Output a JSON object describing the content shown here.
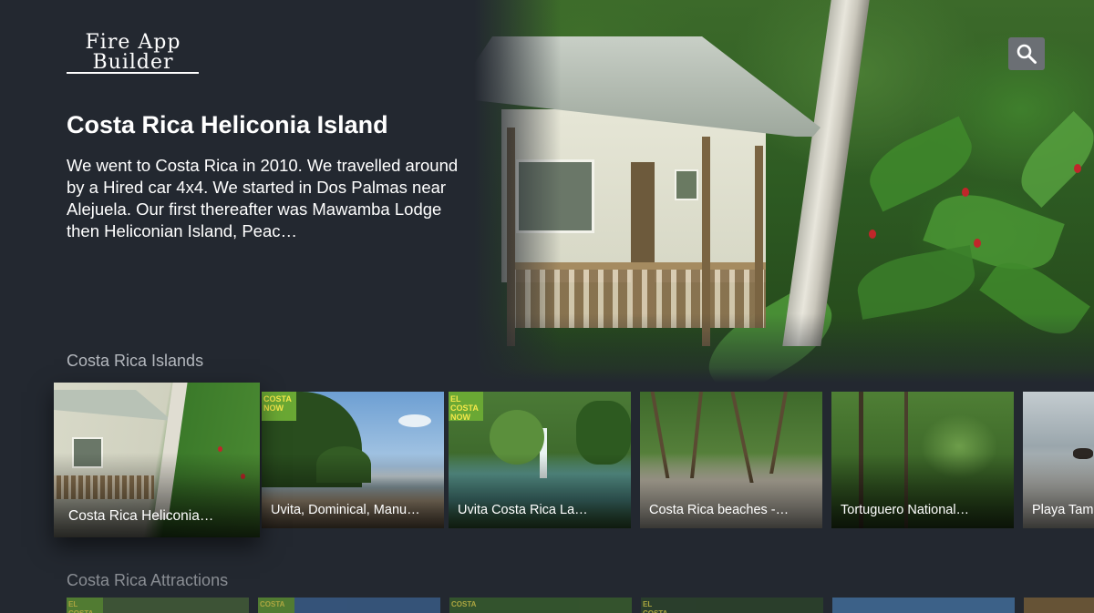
{
  "app": {
    "logo_line1": "Fire App",
    "logo_line2": "Builder"
  },
  "header": {
    "search_icon": "search-icon"
  },
  "featured": {
    "title": "Costa Rica Heliconia Island",
    "description": "We went to Costa Rica in 2010. We travelled around by a Hired car 4x4. We started in Dos Palmas near Alejuela. Our first thereafter was Mawamba Lodge then Heliconian Island, Peac…"
  },
  "rows": [
    {
      "title": "Costa Rica Islands",
      "items": [
        {
          "caption": "Costa Rica Heliconia…",
          "badge": ""
        },
        {
          "caption": "Uvita, Dominical, Manu…",
          "badge": "COSTA NOW"
        },
        {
          "caption": "Uvita Costa Rica La…",
          "badge": "EL COSTA NOW"
        },
        {
          "caption": "Costa Rica beaches -…",
          "badge": ""
        },
        {
          "caption": "Tortuguero National…",
          "badge": ""
        },
        {
          "caption": "Playa Tam",
          "badge": ""
        }
      ]
    },
    {
      "title": "Costa Rica Attractions",
      "items": [
        {
          "badge": "EL COSTA"
        },
        {
          "badge": "COSTA"
        },
        {
          "badge": "COSTA"
        },
        {
          "badge": "EL COSTA"
        },
        {
          "badge": ""
        },
        {
          "badge": ""
        }
      ]
    }
  ],
  "colors": {
    "background": "#232830",
    "search_button": "#6b6f74",
    "row_title": "#b4b8be"
  }
}
